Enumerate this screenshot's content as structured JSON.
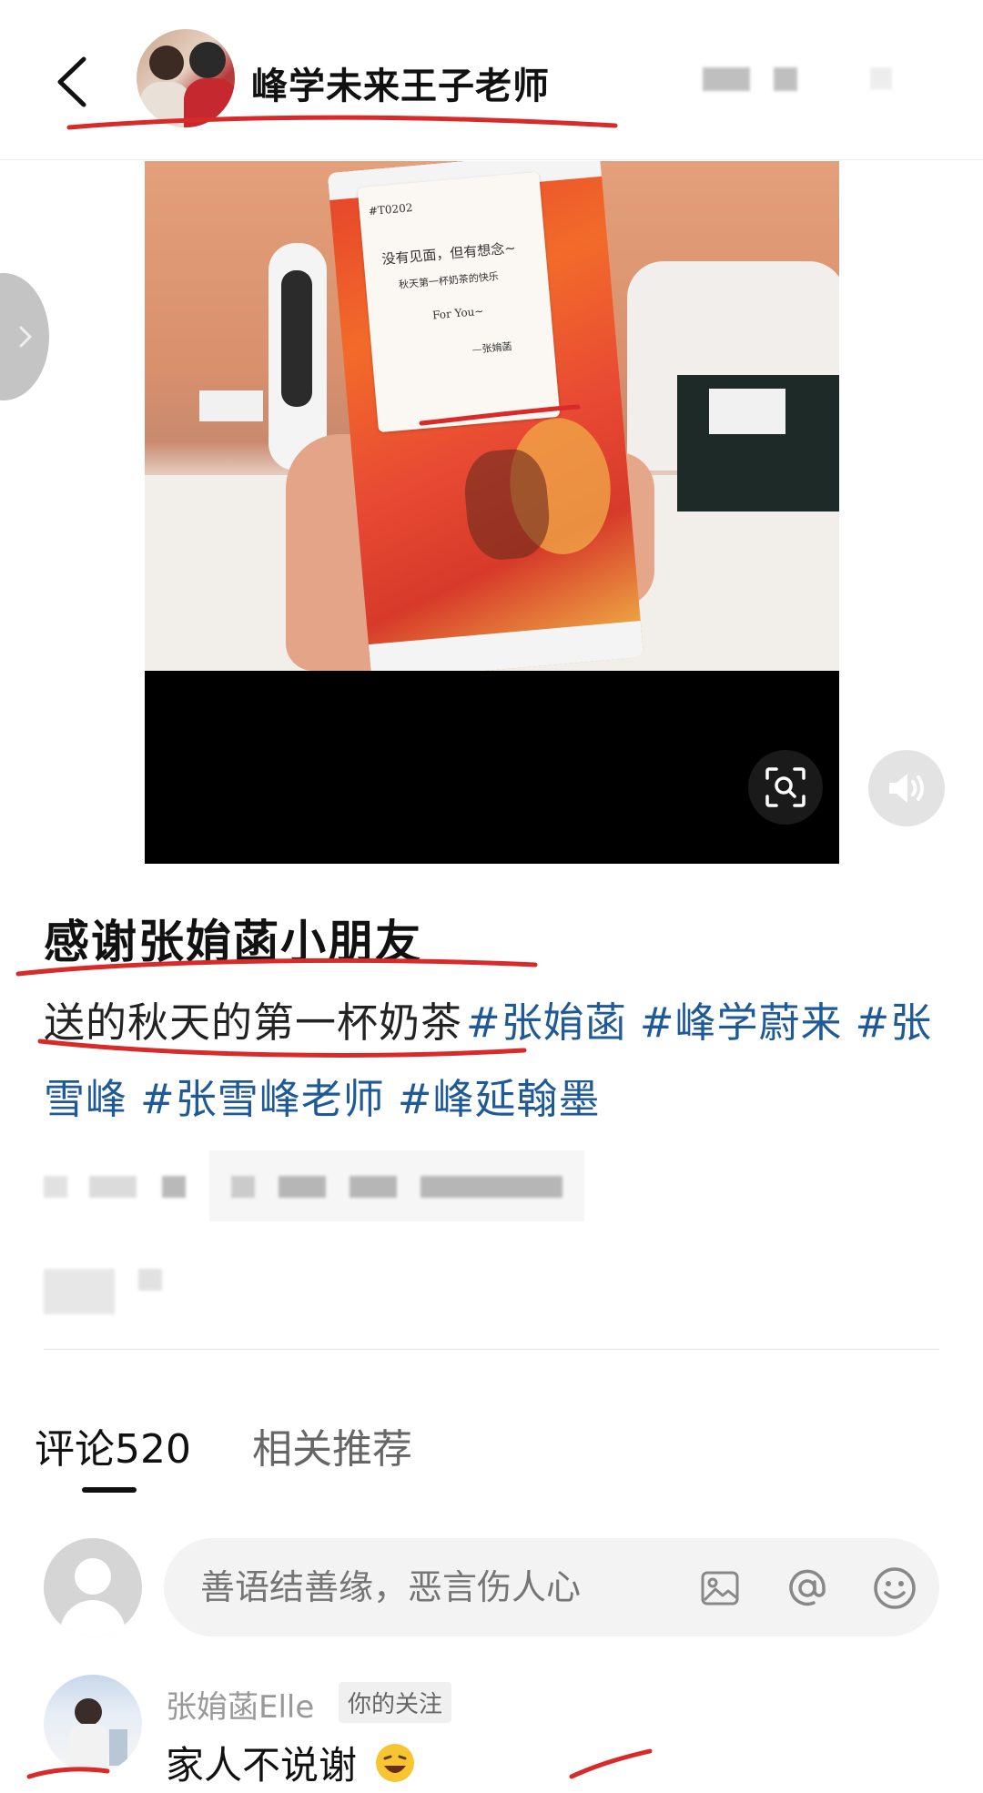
{
  "header": {
    "author_name": "峰学未来王子老师"
  },
  "media": {
    "note_lines": [
      "#T0202",
      "没有见面，但有想念~",
      "秋天第一杯奶茶的快乐",
      "For You~",
      "—张姢菡"
    ]
  },
  "post": {
    "title": "感谢张姢菡小朋友",
    "body_text": "送的秋天的第一杯奶茶",
    "hashtags": [
      "#张姢菡",
      "#峰学蔚来",
      "#张雪峰",
      "#张雪峰老师",
      "#峰延翰墨"
    ]
  },
  "tabs": {
    "comments": "评论520",
    "related": "相关推荐"
  },
  "comment_input": {
    "placeholder": "善语结善缘，恶言伤人心"
  },
  "comment": {
    "username": "张姢菡Elle",
    "badge": "你的关注",
    "text": "家人不说谢"
  },
  "colors": {
    "hashtag": "#1f5a96",
    "annotation_underline": "#d92a2a"
  }
}
